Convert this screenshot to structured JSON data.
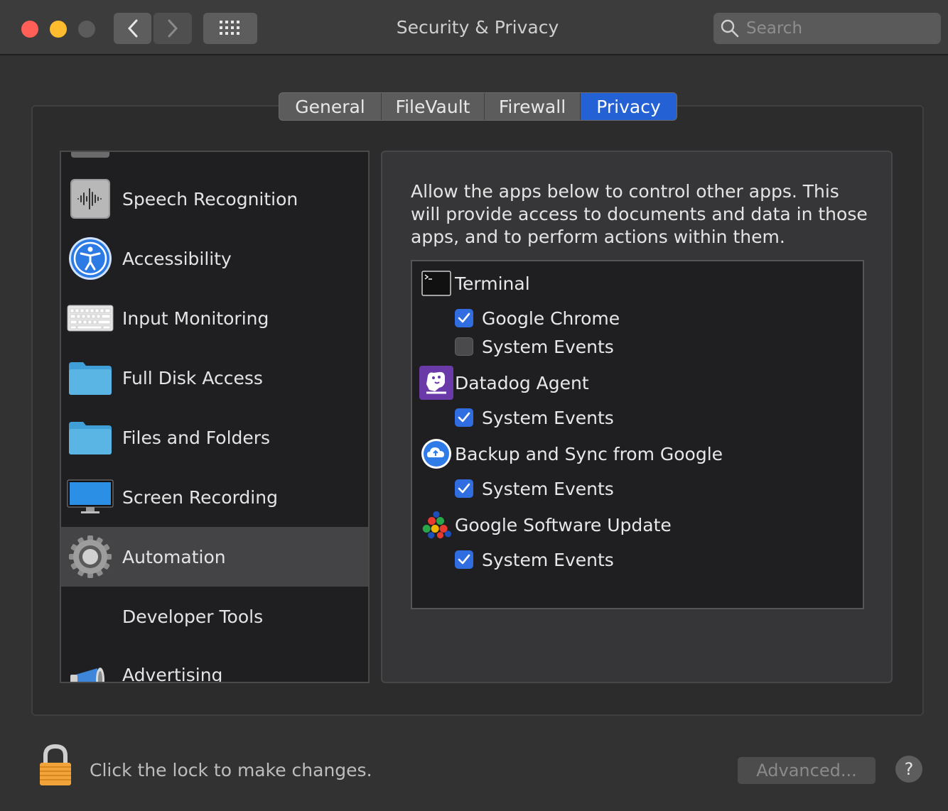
{
  "window": {
    "title": "Security & Privacy",
    "search_placeholder": "Search"
  },
  "tabs": [
    {
      "label": "General",
      "selected": false
    },
    {
      "label": "FileVault",
      "selected": false
    },
    {
      "label": "Firewall",
      "selected": false
    },
    {
      "label": "Privacy",
      "selected": true
    }
  ],
  "sidebar": {
    "items": [
      {
        "label": "Speech Recognition",
        "icon": "waveform-icon",
        "selected": false
      },
      {
        "label": "Accessibility",
        "icon": "accessibility-icon",
        "selected": false
      },
      {
        "label": "Input Monitoring",
        "icon": "keyboard-icon",
        "selected": false
      },
      {
        "label": "Full Disk Access",
        "icon": "folder-icon",
        "selected": false
      },
      {
        "label": "Files and Folders",
        "icon": "folder-icon",
        "selected": false
      },
      {
        "label": "Screen Recording",
        "icon": "display-icon",
        "selected": false
      },
      {
        "label": "Automation",
        "icon": "gear-icon",
        "selected": true
      },
      {
        "label": "Developer Tools",
        "icon": "",
        "selected": false
      },
      {
        "label": "Advertising",
        "icon": "megaphone-icon",
        "selected": false
      }
    ]
  },
  "main": {
    "description": "Allow the apps below to control other apps. This will provide access to documents and data in those apps, and to perform actions within them.",
    "apps": [
      {
        "name": "Terminal",
        "icon": "terminal-icon",
        "targets": [
          {
            "label": "Google Chrome",
            "checked": true
          },
          {
            "label": "System Events",
            "checked": false
          }
        ]
      },
      {
        "name": "Datadog Agent",
        "icon": "datadog-icon",
        "targets": [
          {
            "label": "System Events",
            "checked": true
          }
        ]
      },
      {
        "name": "Backup and Sync from Google",
        "icon": "cloud-upload-icon",
        "targets": [
          {
            "label": "System Events",
            "checked": true
          }
        ]
      },
      {
        "name": "Google Software Update",
        "icon": "colored-balls-icon",
        "targets": [
          {
            "label": "System Events",
            "checked": true
          }
        ]
      }
    ]
  },
  "footer": {
    "lock_message": "Click the lock to make changes.",
    "advanced_label": "Advanced...",
    "help_label": "?"
  },
  "colors": {
    "accent": "#2361d4",
    "checkbox_on": "#2f6de1",
    "close": "#ff5f57",
    "minimize": "#febc2e"
  }
}
